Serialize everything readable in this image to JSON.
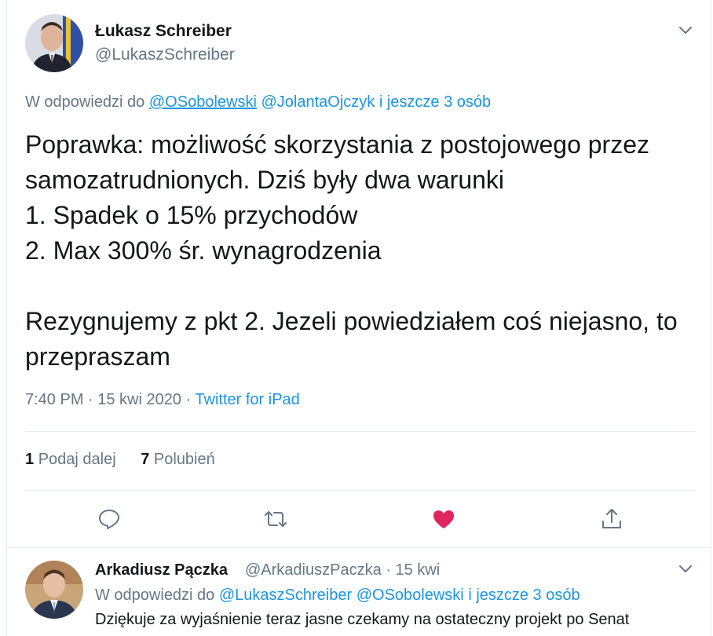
{
  "main_tweet": {
    "author": {
      "name": "Łukasz Schreiber",
      "handle": "@LukaszSchreiber"
    },
    "reply_to": {
      "prefix": "W odpowiedzi do",
      "mention1": "@OSobolewski",
      "mention2": "@JolantaOjczyk",
      "more": "i jeszcze 3 osób"
    },
    "text": "Poprawka: możliwość skorzystania z postojowego przez samozatrudnionych. Dziś były dwa warunki\n1. Spadek o 15% przychodów\n2. Max 300% śr. wynagrodzenia\n\nRezygnujemy z pkt 2. Jezeli powiedziałem coś niejasno, to przepraszam",
    "timestamp": "7:40 PM · 15 kwi 2020 ·",
    "source": "Twitter for iPad",
    "retweets": {
      "count": "1",
      "label": "Podaj dalej"
    },
    "likes": {
      "count": "7",
      "label": "Polubień"
    },
    "actions": [
      "reply-icon",
      "retweet-icon",
      "like-icon",
      "share-icon"
    ],
    "colors": {
      "like": "#e0245e",
      "link": "#1b95e0",
      "muted": "#657786"
    }
  },
  "reply_tweet": {
    "author": {
      "name": "Arkadiusz Pączka",
      "handle": "@ArkadiuszPaczka",
      "date": "· 15 kwi"
    },
    "reply_to": {
      "prefix": "W odpowiedzi do",
      "mention1": "@LukaszSchreiber",
      "mention2": "@OSobolewski",
      "more": "i jeszcze 3 osób"
    },
    "text": "Dziękuje za wyjaśnienie teraz jasne czekamy na ostateczny projekt po Senat"
  }
}
